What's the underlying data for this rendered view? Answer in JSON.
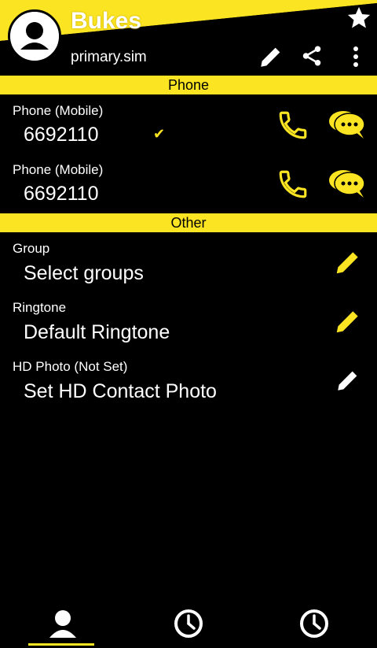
{
  "header": {
    "name": "Bukes",
    "account": "primary.sim",
    "accent_color": "#fbe422",
    "icons": [
      "avatar",
      "star-icon",
      "edit-icon",
      "share-icon",
      "more-vert-icon"
    ]
  },
  "sections": {
    "phone": "Phone",
    "other": "Other"
  },
  "phones": [
    {
      "label": "Phone  (Mobile)",
      "number": "6692110",
      "check": "✔"
    },
    {
      "label": "Phone  (Mobile)",
      "number": "6692110"
    }
  ],
  "other": {
    "group_label": "Group",
    "group_value": "Select groups",
    "ringtone_label": "Ringtone",
    "ringtone_value": "Default Ringtone",
    "photo_label": "HD Photo (Not Set)",
    "photo_value": "Set HD Contact Photo"
  },
  "bottom_nav": [
    "contact-tab-icon",
    "recent-calls-tab-icon",
    "history-tab-icon"
  ]
}
